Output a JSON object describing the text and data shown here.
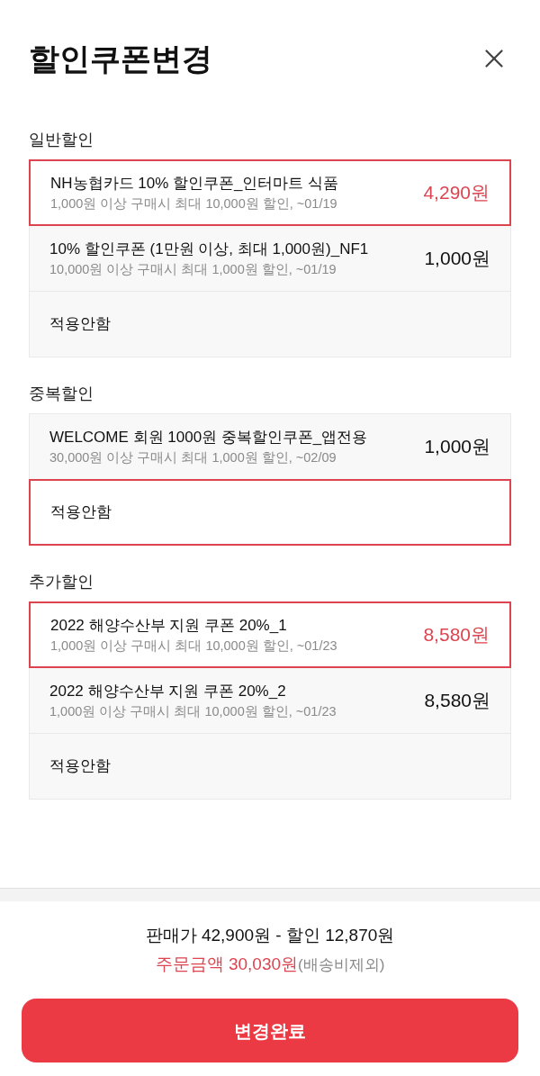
{
  "header": {
    "title": "할인쿠폰변경"
  },
  "sections": [
    {
      "label": "일반할인",
      "options": [
        {
          "kind": "coupon",
          "title": "NH농협카드 10% 할인쿠폰_인터마트 식품",
          "condition": "1,000원 이상 구매시 최대 10,000원 할인, ~01/19",
          "amount": "4,290원",
          "selected": true
        },
        {
          "kind": "coupon",
          "title": "10% 할인쿠폰 (1만원 이상, 최대 1,000원)_NF1",
          "condition": "10,000원 이상 구매시 최대 1,000원 할인, ~01/19",
          "amount": "1,000원",
          "selected": false
        },
        {
          "kind": "none",
          "title": "적용안함",
          "selected": false
        }
      ]
    },
    {
      "label": "중복할인",
      "options": [
        {
          "kind": "coupon",
          "title": "WELCOME 회원 1000원 중복할인쿠폰_앱전용",
          "condition": "30,000원 이상 구매시 최대 1,000원 할인, ~02/09",
          "amount": "1,000원",
          "selected": false
        },
        {
          "kind": "none",
          "title": "적용안함",
          "selected": true
        }
      ]
    },
    {
      "label": "추가할인",
      "options": [
        {
          "kind": "coupon",
          "title": "2022 해양수산부 지원 쿠폰 20%_1",
          "condition": "1,000원 이상 구매시 최대 10,000원 할인, ~01/23",
          "amount": "8,580원",
          "selected": true
        },
        {
          "kind": "coupon",
          "title": "2022 해양수산부 지원 쿠폰 20%_2",
          "condition": "1,000원 이상 구매시 최대 10,000원 할인, ~01/23",
          "amount": "8,580원",
          "selected": false
        },
        {
          "kind": "none",
          "title": "적용안함",
          "selected": false
        }
      ]
    }
  ],
  "summary": {
    "price_line": "판매가 42,900원 - 할인 12,870원",
    "order_total": "주문금액 30,030원",
    "shipping_note": "(배송비제외)"
  },
  "confirm_button": "변경완료"
}
